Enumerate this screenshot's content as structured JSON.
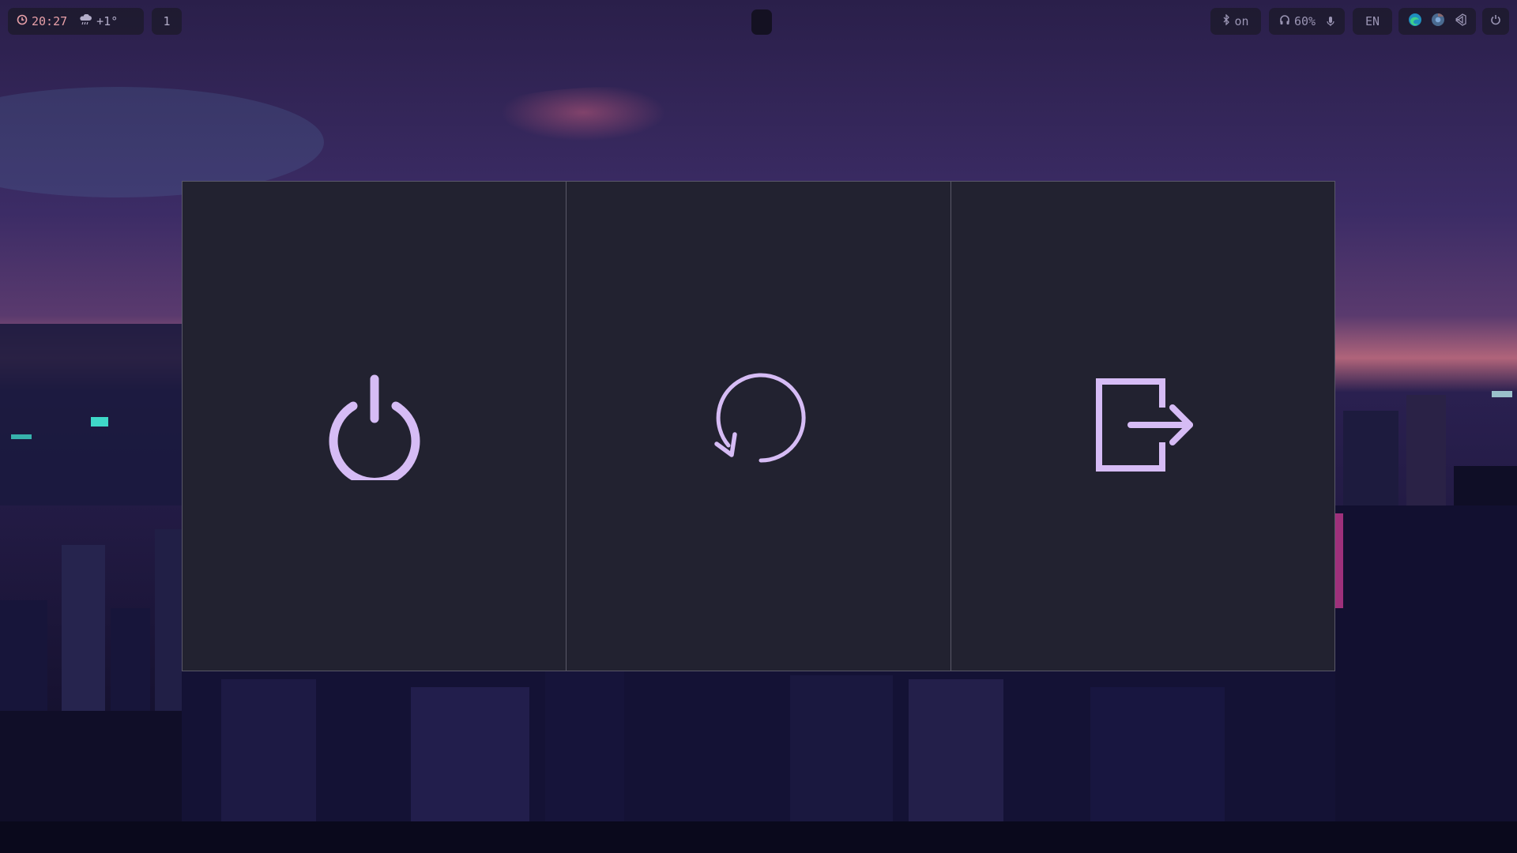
{
  "topbar": {
    "clock": {
      "icon": "clock-icon",
      "time": "20:27"
    },
    "weather": {
      "icon": "cloud-rain-icon",
      "temperature": "+1°"
    },
    "workspace": {
      "active": "1"
    },
    "bluetooth": {
      "icon": "bluetooth-icon",
      "status": "on"
    },
    "audio": {
      "icon": "headphones-icon",
      "volume": "60%",
      "mic_icon": "microphone-icon"
    },
    "keyboard_layout": "EN",
    "tray": {
      "icons": [
        "edge-browser-icon",
        "chrome-browser-icon",
        "vscode-icon"
      ]
    },
    "power_icon": "power-icon"
  },
  "power_menu": {
    "accent_color": "#d6bcf5",
    "options": [
      {
        "icon": "shutdown-icon"
      },
      {
        "icon": "reboot-icon"
      },
      {
        "icon": "logout-icon"
      }
    ]
  },
  "colors": {
    "menu_background": "#222230",
    "menu_border": "#5a5868",
    "bar_background": "#1c1a2a"
  }
}
